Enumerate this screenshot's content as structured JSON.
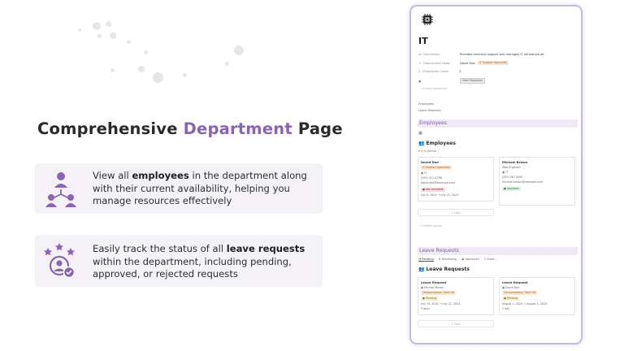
{
  "headline": {
    "part1": "Comprehensive ",
    "accent": "Department",
    "part2": " Page"
  },
  "features": [
    {
      "icon": "team-hierarchy-icon",
      "pre": "View all ",
      "bold": "employees",
      "post": " in the department along with their current availability, helping you manage resources effectively"
    },
    {
      "icon": "user-approval-icon",
      "pre": "Easily track the status of all ",
      "bold": "leave requests",
      "post": " within the department, including pending, approved, or rejected requests"
    }
  ],
  "colors": {
    "accent": "#8a63b8",
    "card_bg": "#f4f2f6",
    "frame": "#c9b8de"
  },
  "app": {
    "page_title": "IT",
    "properties": [
      {
        "key": "Description",
        "value": "Provides technical support and manages IT infrastructure"
      },
      {
        "key": "Department Head",
        "value": "David Doe",
        "tag": "IT Support Specialist"
      },
      {
        "key": "Employees Count",
        "value": "2"
      },
      {
        "key": "",
        "value": "New Employee"
      }
    ],
    "more_props": "4 more properties",
    "links": [
      "Employees",
      "Leave Requests"
    ],
    "employees_section": "Employees",
    "employees_view": "Employees",
    "filter": "Is Active",
    "employees": [
      {
        "name": "David Doe",
        "role": "IT Support Specialist",
        "dept": "IT",
        "phone": "(555) 321-0788",
        "email": "david.doe@example.com",
        "status": "Not Available",
        "dates": "July 8, 2024 → July 15, 2024"
      },
      {
        "name": "Michael Brown",
        "role": "Web Engineer",
        "dept": "IT",
        "phone": "(555) 567-8901",
        "email": "michael.brown@example.com",
        "status": "Available",
        "dates": ""
      }
    ],
    "new_label": "+ New",
    "hidden_group": "1 hidden group",
    "leave_section": "Leave Requests",
    "leave_tabs": [
      "Pending",
      "Reviewing",
      "Approved",
      "1 more..."
    ],
    "leave_view": "Leave Requests",
    "leaves": [
      {
        "title": "Leave Request",
        "person": "Michael Brown",
        "type": "Compensatory Time Off",
        "status": "Pending",
        "dates": "July 19, 2024 → July 21, 2024",
        "days": "3 days"
      },
      {
        "title": "Leave Request",
        "person": "David Doe",
        "type": "Compensatory Time Off",
        "status": "Pending",
        "dates": "August 1, 2024 → August 1, 2024",
        "days": "1 day"
      }
    ]
  }
}
